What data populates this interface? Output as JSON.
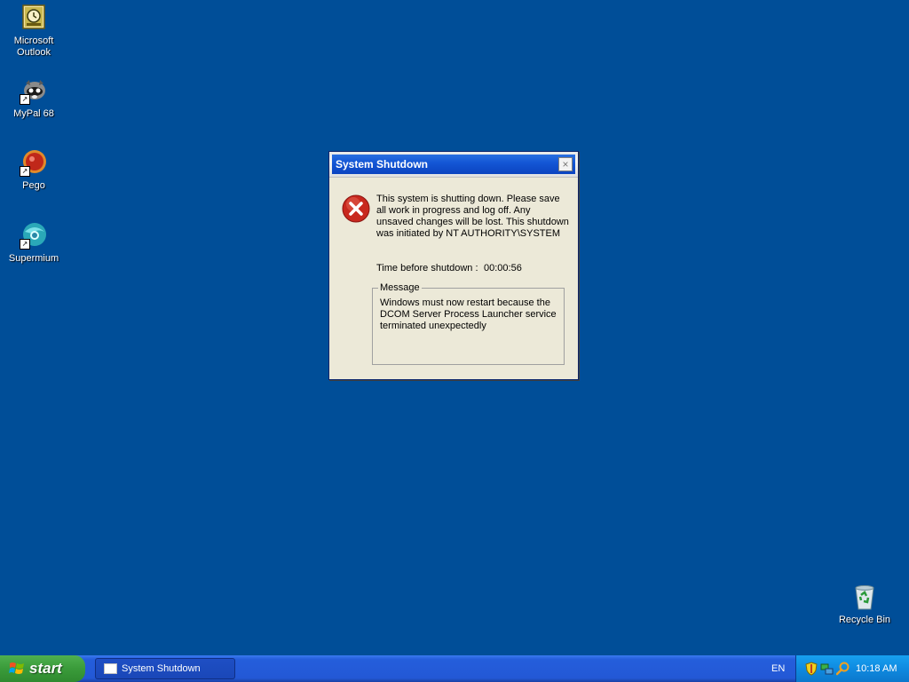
{
  "desktop": {
    "icons": [
      {
        "label": "Microsoft\nOutlook",
        "icon": "outlook-icon"
      },
      {
        "label": "MyPal 68",
        "icon": "mypal-icon"
      },
      {
        "label": "Pego",
        "icon": "pego-icon"
      },
      {
        "label": "Supermium",
        "icon": "supermium-icon"
      },
      {
        "label": "Recycle Bin",
        "icon": "recycle-bin-icon"
      }
    ],
    "background_color": "#004e98"
  },
  "dialog": {
    "title": "System Shutdown",
    "close_glyph": "×",
    "main_message": "This system is shutting down. Please save all work in progress and log off. Any unsaved changes will be lost. This shutdown was initiated by NT AUTHORITY\\SYSTEM",
    "time_label": "Time before shutdown :",
    "time_value": "00:00:56",
    "message_group_label": "Message",
    "message_body": "Windows must now restart because the DCOM Server Process Launcher service terminated unexpectedly",
    "icon": "error-icon"
  },
  "taskbar": {
    "start_label": "start",
    "task_button_label": "System Shutdown",
    "language": "EN",
    "clock": "10:18 AM",
    "tray_icons": [
      "security-shield-icon",
      "network-icon",
      "search-icon"
    ]
  }
}
